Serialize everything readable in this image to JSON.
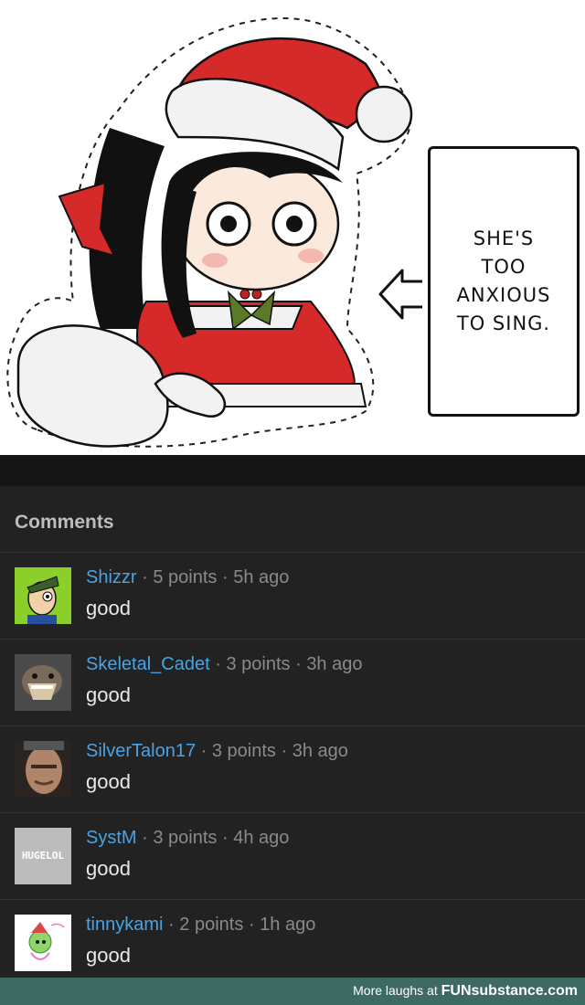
{
  "comic": {
    "speech_lines": [
      "SHE'S",
      "TOO",
      "ANXIOUS",
      "TO SING."
    ]
  },
  "comments_section": {
    "title": "Comments",
    "separator": "·",
    "items": [
      {
        "username": "Shizzr",
        "points": "5 points",
        "age": "5h ago",
        "body": "good"
      },
      {
        "username": "Skeletal_Cadet",
        "points": "3 points",
        "age": "3h ago",
        "body": "good"
      },
      {
        "username": "SilverTalon17",
        "points": "3 points",
        "age": "3h ago",
        "body": "good"
      },
      {
        "username": "SystM",
        "points": "3 points",
        "age": "4h ago",
        "body": "good",
        "avatar_text": "HUGELOL"
      },
      {
        "username": "tinnykami",
        "points": "2 points",
        "age": "1h ago",
        "body": "good"
      }
    ]
  },
  "footer": {
    "prefix": "More laughs at",
    "brand": "FUNsubstance.com"
  },
  "colors": {
    "username": "#4aa3e4",
    "background": "#222222",
    "footer": "#3e6a64"
  }
}
